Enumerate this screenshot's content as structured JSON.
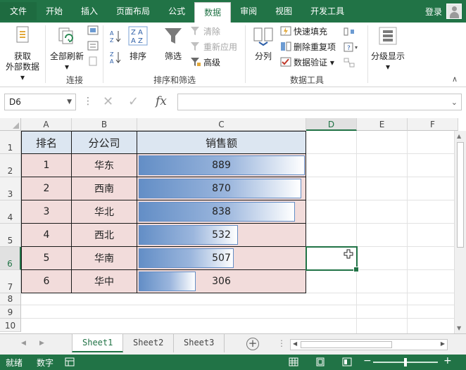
{
  "ribbon_tabs": [
    "文件",
    "开始",
    "插入",
    "页面布局",
    "公式",
    "数据",
    "审阅",
    "视图",
    "开发工具"
  ],
  "active_tab": "数据",
  "login_label": "登录",
  "groups": {
    "connections": {
      "get_external_line1": "获取",
      "get_external_line2": "外部数据",
      "refresh_all": "全部刷新",
      "label": "连接"
    },
    "sort_filter": {
      "sort": "排序",
      "filter": "筛选",
      "clear": "清除",
      "reapply": "重新应用",
      "advanced": "高级",
      "label": "排序和筛选"
    },
    "data_tools": {
      "text_to_columns": "分列",
      "flash_fill": "快速填充",
      "remove_duplicates": "删除重复项",
      "data_validation": "数据验证",
      "label": "数据工具"
    },
    "outline": {
      "outline": "分级显示"
    }
  },
  "name_box": "D6",
  "formula_value": "",
  "columns": [
    "A",
    "B",
    "C",
    "D",
    "E",
    "F"
  ],
  "rows": [
    "1",
    "2",
    "3",
    "4",
    "5",
    "6",
    "7",
    "8",
    "9",
    "10"
  ],
  "selected_cell": {
    "col": "D",
    "row": "6"
  },
  "table": {
    "headers": [
      "排名",
      "分公司",
      "销售额"
    ],
    "rows": [
      {
        "rank": "1",
        "branch": "华东",
        "sales": "889"
      },
      {
        "rank": "2",
        "branch": "西南",
        "sales": "870"
      },
      {
        "rank": "3",
        "branch": "华北",
        "sales": "838"
      },
      {
        "rank": "4",
        "branch": "西北",
        "sales": "532"
      },
      {
        "rank": "5",
        "branch": "华南",
        "sales": "507"
      },
      {
        "rank": "6",
        "branch": "华中",
        "sales": "306"
      }
    ],
    "data_bar_max": 889,
    "data_bar_color": "#638ec6"
  },
  "sheets": [
    "Sheet1",
    "Sheet2",
    "Sheet3"
  ],
  "active_sheet": "Sheet1",
  "status": {
    "ready": "就绪",
    "mode": "数字"
  },
  "colors": {
    "excel_green": "#217346",
    "header_fill": "#dce6f1",
    "body_fill": "#f2dcdb"
  }
}
